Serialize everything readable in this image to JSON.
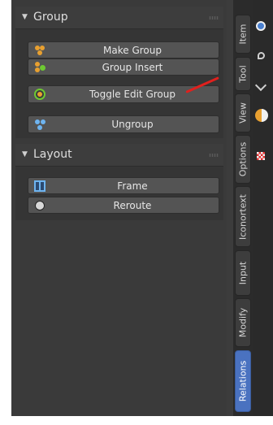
{
  "panels": {
    "group": {
      "title": "Group",
      "buttons": [
        {
          "label": "Make Group",
          "icon": "make-group-icon"
        },
        {
          "label": "Group Insert",
          "icon": "group-insert-icon"
        },
        {
          "label": "Toggle Edit Group",
          "icon": "toggle-edit-group-icon"
        },
        {
          "label": "Ungroup",
          "icon": "ungroup-icon"
        }
      ]
    },
    "layout": {
      "title": "Layout",
      "buttons": [
        {
          "label": "Frame",
          "icon": "frame-icon"
        },
        {
          "label": "Reroute",
          "icon": "reroute-icon"
        }
      ]
    }
  },
  "tabs": [
    {
      "label": "Item",
      "active": false
    },
    {
      "label": "Tool",
      "active": false
    },
    {
      "label": "View",
      "active": false
    },
    {
      "label": "Options",
      "active": false
    },
    {
      "label": "Iconortext",
      "active": false
    },
    {
      "label": "Input",
      "active": false
    },
    {
      "label": "Modify",
      "active": false
    },
    {
      "label": "Relations",
      "active": true
    }
  ],
  "colors": {
    "active_tab": "#4a72c0",
    "annotation_line": "#e0201d",
    "group_icon_orange": "#e8a030",
    "group_icon_green": "#6ec832",
    "ungroup_icon_blue": "#6eb4f0"
  }
}
